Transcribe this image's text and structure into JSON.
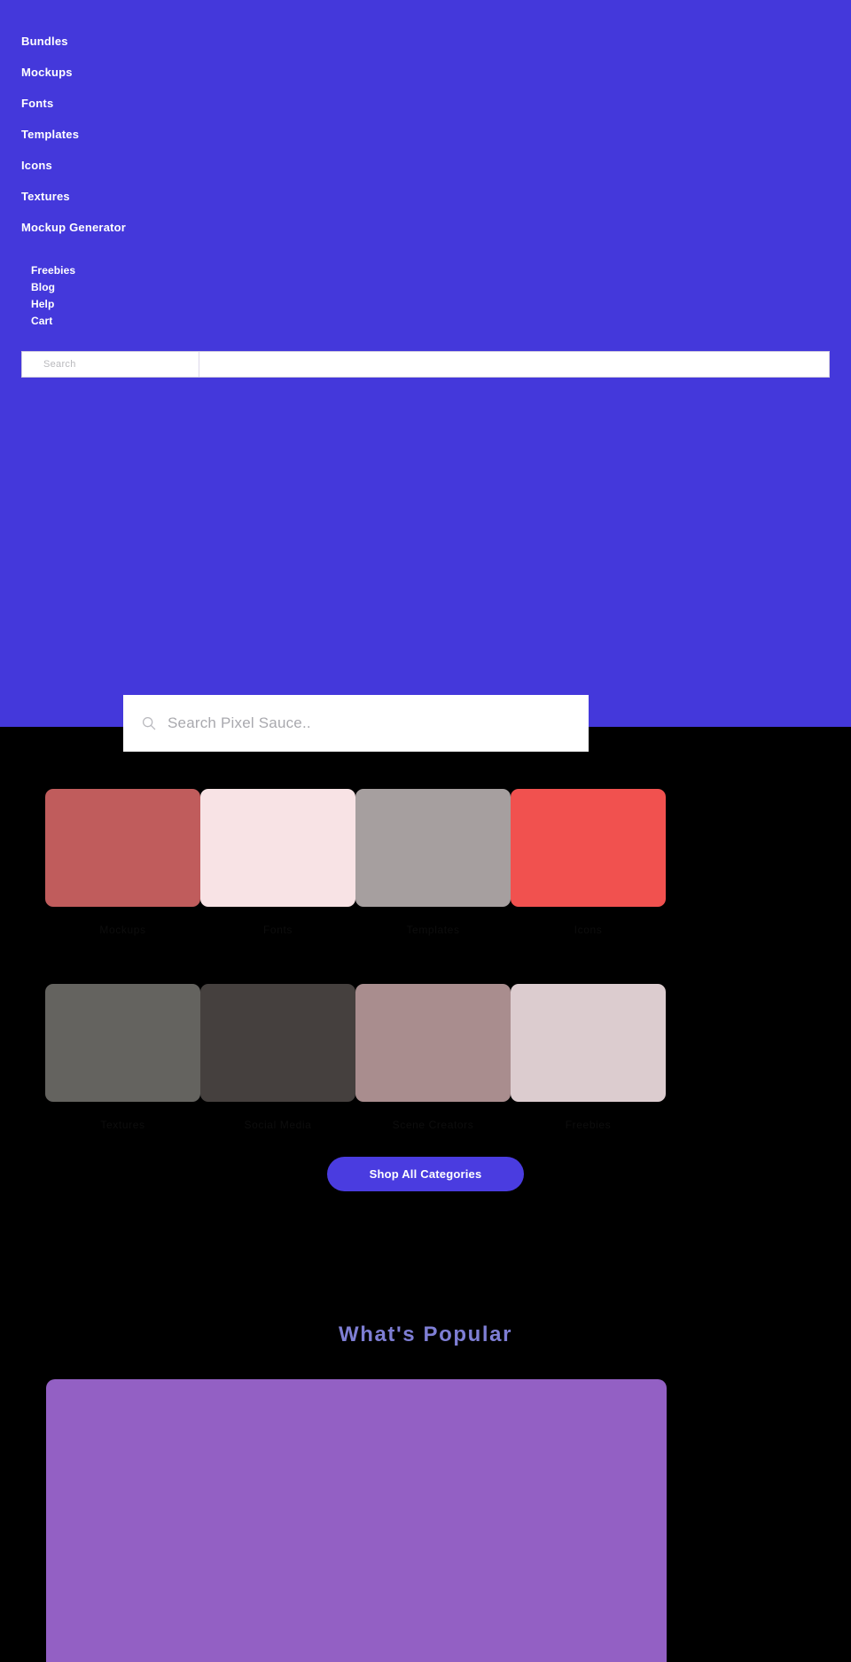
{
  "colors": {
    "brand_purple": "#4438db",
    "button_purple": "#4a3ce0",
    "page_background": "#000000",
    "heading_purple": "#7e7ed4",
    "popular_card": "#9360c4"
  },
  "nav": {
    "primary": [
      {
        "label": "Bundles"
      },
      {
        "label": "Mockups"
      },
      {
        "label": "Fonts"
      },
      {
        "label": "Templates"
      },
      {
        "label": "Icons"
      },
      {
        "label": "Textures"
      },
      {
        "label": "Mockup Generator"
      }
    ],
    "secondary": [
      {
        "label": "Freebies"
      },
      {
        "label": "Blog"
      },
      {
        "label": "Help"
      },
      {
        "label": "Cart"
      }
    ]
  },
  "topbar_search": {
    "placeholder": "Search"
  },
  "hero_search": {
    "placeholder": "Search Pixel Sauce..",
    "icon": "search-icon"
  },
  "categories": {
    "row1": [
      {
        "label": "Mockups",
        "color": "#c05c5c"
      },
      {
        "label": "Fonts",
        "color": "#f8e3e5"
      },
      {
        "label": "Templates",
        "color": "#a69f9f"
      },
      {
        "label": "Icons",
        "color": "#f1514f"
      }
    ],
    "row2": [
      {
        "label": "Textures",
        "color": "#64635f"
      },
      {
        "label": "Social Media",
        "color": "#45403e"
      },
      {
        "label": "Scene Creators",
        "color": "#a98d8e"
      },
      {
        "label": "Freebies",
        "color": "#dccccf"
      }
    ]
  },
  "shop_all": {
    "label": "Shop All Categories"
  },
  "popular": {
    "heading": "What's Popular"
  }
}
